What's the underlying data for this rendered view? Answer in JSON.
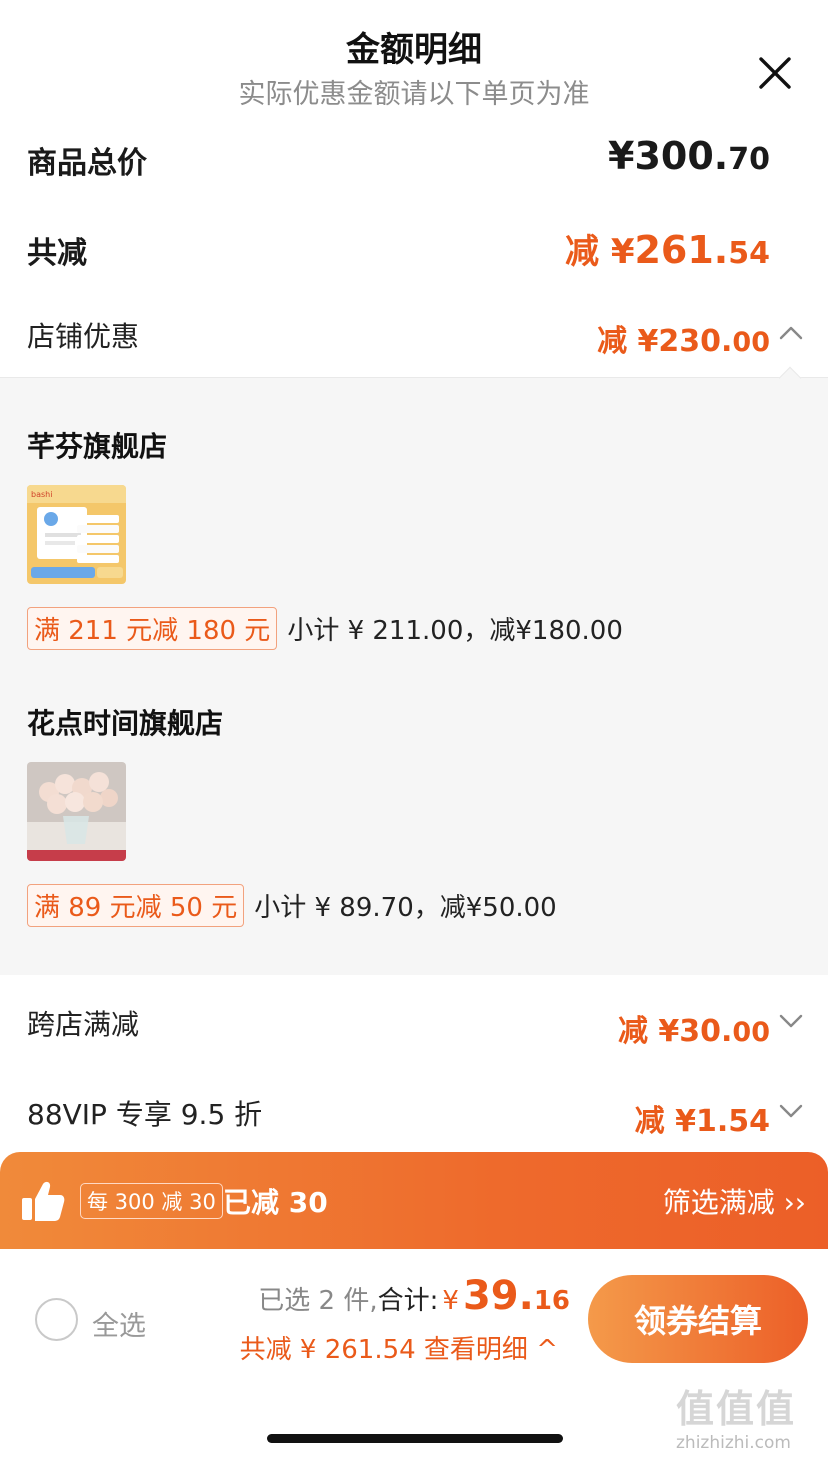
{
  "header": {
    "title": "金额明细",
    "subtitle": "实际优惠金额请以下单页为准",
    "close_icon": "close-icon"
  },
  "summary": {
    "goods_total_label": "商品总价",
    "goods_total_int": "¥300.",
    "goods_total_dec": "70",
    "total_discount_label": "共减",
    "total_discount_prefix": "减 ¥",
    "total_discount_int": "261.",
    "total_discount_dec": "54"
  },
  "store_discount": {
    "label": "店铺优惠",
    "value_int": "减 ¥230.",
    "value_dec": "00",
    "expanded": true,
    "stores": [
      {
        "name": "芊芬旗舰店",
        "product_image_icon": "baby-wipes-product-image",
        "promo_tag": "满 211 元减 180 元",
        "promo_text": "小计 ¥ 211.00，减¥180.00"
      },
      {
        "name": "花点时间旗舰店",
        "product_image_icon": "rose-bouquet-product-image",
        "promo_tag": "满 89 元减 50 元",
        "promo_text": "小计 ¥ 89.70，减¥50.00"
      }
    ]
  },
  "cross_store": {
    "label": "跨店满减",
    "value_int": "减 ¥30.",
    "value_dec": "00"
  },
  "vip": {
    "label": "88VIP 专享 9.5 折",
    "value": "减 ¥1.54"
  },
  "promo_bar": {
    "icon": "thumbs-up-icon",
    "rule_badge": "每 300 减 30",
    "reduced_text": "已减 30",
    "filter_link": "筛选满减 ››"
  },
  "footer": {
    "select_all": "全选",
    "selected_count": "已选 2 件,",
    "total_label": "合计:",
    "currency": "¥",
    "total_int": "39.",
    "total_dec": "16",
    "saved_text": "共减 ¥ 261.54  查看明细 ^",
    "checkout_button": "领券结算"
  },
  "watermark": {
    "glyphs": "值值值",
    "url": "zhizhizhi.com"
  },
  "colors": {
    "accent": "#ea5a1a",
    "promo_bar_start": "#f08a3a",
    "promo_bar_end": "#ec5f28",
    "panel_bg": "#f6f6f6"
  }
}
